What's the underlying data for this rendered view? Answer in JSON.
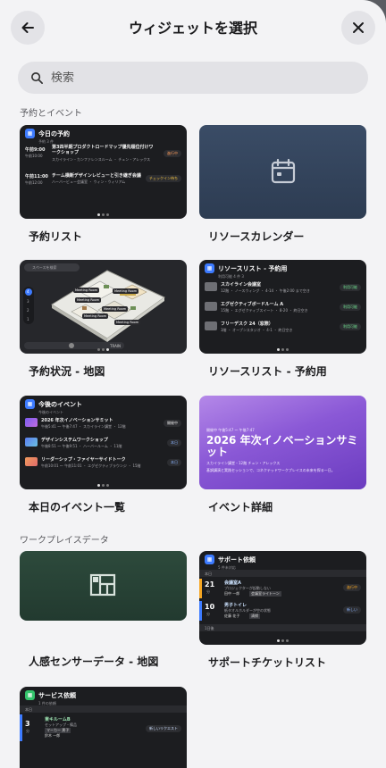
{
  "header": {
    "title": "ウィジェットを選択",
    "back_icon": "arrow-left-icon",
    "close_icon": "close-icon"
  },
  "search": {
    "placeholder": "検索",
    "value": ""
  },
  "sections": [
    {
      "label": "予約とイベント",
      "cards": [
        {
          "title": "予約リスト",
          "widget": {
            "title": "今日の予約",
            "subtitle": "予約 3 件",
            "items": [
              {
                "time": "午前9:00",
                "time2": "午前10:00",
                "name": "第3四半期プロダクトロードマップ優先順位付けワークショップ",
                "detail": "スカイライン・カンファレンスルーム ・ チュン・アレックス",
                "badge": "進行中"
              },
              {
                "time": "午前11:00",
                "time2": "午前12:00",
                "name": "チーム横断デザインレビューと引き継ぎ会議",
                "detail": "ハーバービュー会議室 ・ ウィン・ウィリアム",
                "badge": "チェックイン待ち"
              }
            ]
          }
        },
        {
          "title": "リソースカレンダー",
          "icon": "calendar-icon"
        },
        {
          "title": "予約状況 - 地図",
          "map": {
            "search": "スペースを検索",
            "floors": [
              "4",
              "3",
              "2",
              "1"
            ],
            "rooms": [
              "Meeting Room",
              "Meeting Room",
              "Meeting Room",
              "Meeting Room",
              "Meeting Room",
              "Meeting Room"
            ],
            "badge": "TRAIN"
          }
        },
        {
          "title": "リソースリスト - 予約用",
          "widget": {
            "title": "リソースリスト - 予約用",
            "subtitle": "利用可能 4 件 3",
            "items": [
              {
                "name": "スカイライン会議室",
                "detail": "12階 ・ ノースウィング ・ 4-14 ・ 午後2:00 まで空き",
                "badge": "利用可能"
              },
              {
                "name": "エグゼクティブボードルーム A",
                "detail": "15階 ・ エグゼクティブスイート ・ 8-20 ・ 終日空き",
                "badge": "利用可能"
              },
              {
                "name": "フリーデスク 24（窓際）",
                "detail": "3階 ・ オープンスタジオ ・ 4-1 ・ 終日空き",
                "badge": "利用可能"
              }
            ]
          }
        },
        {
          "title": "本日のイベント一覧",
          "widget": {
            "title": "今後のイベント",
            "subtitle": "今後のイベント",
            "items": [
              {
                "name": "2026 年次イノベーションサミット",
                "detail": "午後5:41 ～ 午後7:47 ・ スカイライン講堂 ・ 12階",
                "badge": "開催中"
              },
              {
                "name": "デザインシステムワークショップ",
                "detail": "午後8:51 ～ 午後9:51 ・ ハーバールーム ・ 11階",
                "badge": "本日"
              },
              {
                "name": "リーダーシップ・ファイヤーサイドトーク",
                "detail": "午前10:01 ～ 午前11:01 ・ エグゼクティブラウンジ ・ 15階",
                "badge": "本日"
              }
            ]
          }
        },
        {
          "title": "イベント詳細",
          "event": {
            "meta": "開催中  午後5:47 ～ 午後7:47",
            "headline": "2026 年次イノベーションサミット",
            "people": "スカイライン講堂・12階    チュン・アレックス",
            "description": "基調講演と実践セッションで、コネクテッドワークプレイスの未来を探る一日。"
          }
        }
      ]
    },
    {
      "label": "ワークプレイスデータ",
      "cards": [
        {
          "title": "人感センサーデータ - 地図",
          "icon": "floorplan-icon"
        },
        {
          "title": "サポートチケットリスト",
          "widget": {
            "title": "サポート依頼",
            "subtitle": "5 件未対応",
            "group": "本日",
            "group2": "1日後",
            "items": [
              {
                "day": "21",
                "unit": "分",
                "name": "会議室A",
                "detail": "プロジェクターが起動しない",
                "person": "田中 一郎",
                "tag": "会議室ライトーン",
                "badge": "進行中"
              },
              {
                "day": "10",
                "unit": "分",
                "name": "男子トイレ",
                "detail": "紙タオルホルダーが空の状態",
                "person": "佐藤 花子",
                "tag": "清掃",
                "badge": "新しい"
              }
            ]
          }
        },
        {
          "title": "",
          "widget": {
            "title": "サービス依頼",
            "subtitle": "1 件の依頼",
            "group": "本日",
            "items": [
              {
                "day": "3",
                "unit": "分",
                "name": "東キルームB",
                "detail": "セットアップ・備品",
                "person": "鈴木 一郎",
                "tag": "マーカー 黒子",
                "badge": "新しいリクエスト"
              }
            ]
          }
        }
      ]
    }
  ],
  "colors": {
    "accent": "#3d7bff",
    "green": "#33c46b",
    "orange": "#f5a623",
    "event_purple": "#9b6ae0"
  }
}
